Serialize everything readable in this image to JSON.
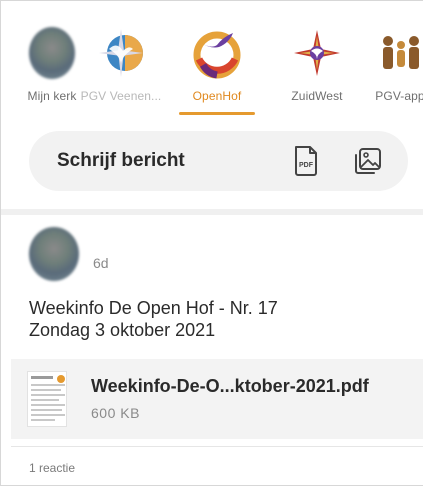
{
  "communities": [
    {
      "label": "Mijn kerk",
      "logo": "user-avatar",
      "active": false
    },
    {
      "label": "PGV Veenen...",
      "logo": "compass-dove-logo",
      "active": false
    },
    {
      "label": "OpenHof",
      "logo": "openhof-dove-logo",
      "active": true
    },
    {
      "label": "ZuidWest",
      "logo": "star-dove-logo",
      "active": false
    },
    {
      "label": "PGV-app",
      "logo": "people-logo",
      "active": false
    }
  ],
  "actions": {
    "write_label": "Schrijf bericht",
    "pdf_icon_text": "PDF",
    "pdf_icon": "pdf-file-icon",
    "image_icon": "image-gallery-icon"
  },
  "post": {
    "time": "6d",
    "text_line1": "Weekinfo De Open Hof - Nr. 17",
    "text_line2": "Zondag 3 oktober 2021",
    "attachment": {
      "filename": "Weekinfo-De-O...ktober-2021.pdf",
      "size": "600 KB"
    },
    "reactions": "1 reactie"
  },
  "colors": {
    "accent": "#e59a2f",
    "pill_bg": "#f2f2f2",
    "divider": "#f0f0f0"
  }
}
